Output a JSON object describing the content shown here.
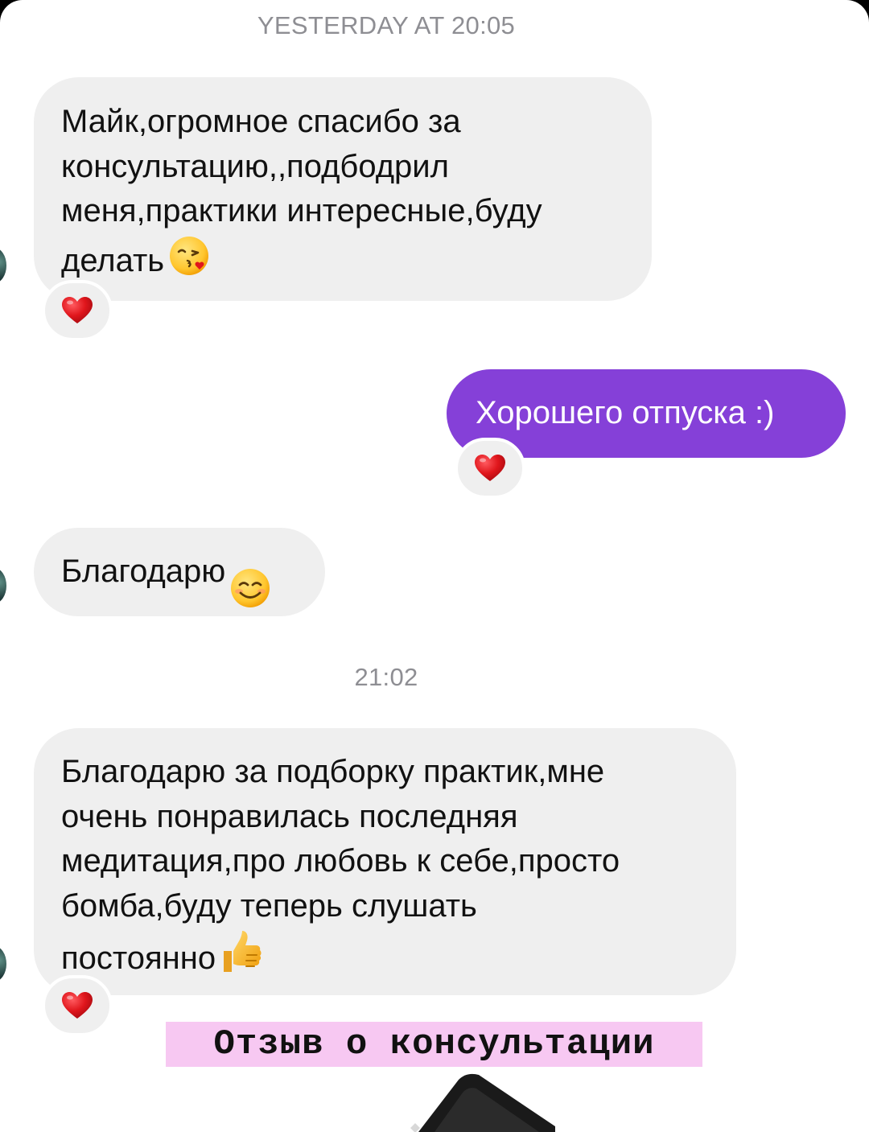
{
  "chat": {
    "timestamp_1": "YESTERDAY AT 20:05",
    "timestamp_2": "21:02",
    "messages": [
      {
        "sender": "incoming",
        "text": "Майк,огромное спасибо за\nконсультацию,,подбодрил\nменя,практики интересные,буду\nделать",
        "emoji": "kissing-heart-emoji",
        "reaction": "red-heart"
      },
      {
        "sender": "outgoing",
        "text": "Хорошего отпуска :)",
        "reaction": "red-heart"
      },
      {
        "sender": "incoming",
        "text": "Благодарю",
        "emoji": "smiling-face-emoji"
      },
      {
        "sender": "incoming",
        "text": "Благодарю за подборку практик,мне\nочень понравилась последняя\nмедитация,про любовь к себе,просто\nбомба,буду теперь слушать\nпостоянно",
        "emoji": "thumbs-up-emoji",
        "reaction": "red-heart"
      }
    ]
  },
  "caption": {
    "text": "Отзыв о консультации",
    "highlight_color": "#f7c8f2"
  },
  "colors": {
    "outgoing_bubble": "#8540d8",
    "incoming_bubble": "#efefef",
    "timestamp": "#8e8e93",
    "reaction_heart": "#e0161c"
  }
}
